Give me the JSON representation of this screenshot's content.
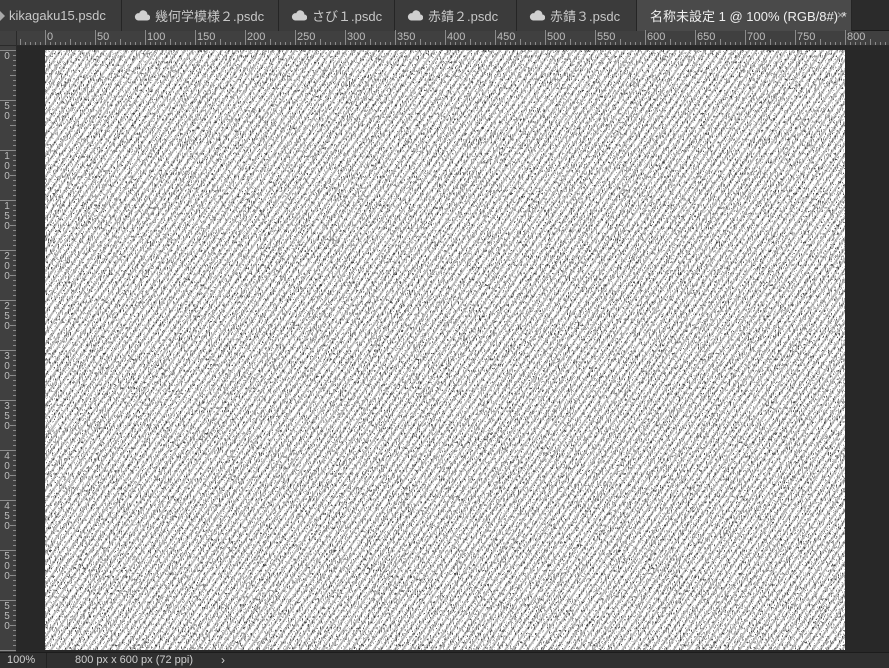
{
  "tabs": [
    {
      "label": "kikagaku15.psdc",
      "cloud": false,
      "active": false
    },
    {
      "label": "幾何学模様２.psdc",
      "cloud": true,
      "active": false
    },
    {
      "label": "さび１.psdc",
      "cloud": true,
      "active": false
    },
    {
      "label": "赤錆２.psdc",
      "cloud": true,
      "active": false
    },
    {
      "label": "赤錆３.psdc",
      "cloud": true,
      "active": false
    },
    {
      "label": "名称未設定 1 @ 100% (RGB/8#) *",
      "cloud": false,
      "active": true
    }
  ],
  "close_glyph": "×",
  "ruler_top_labels": [
    "0",
    "50",
    "100",
    "150",
    "200",
    "250",
    "300",
    "350",
    "400",
    "450",
    "500",
    "550",
    "600",
    "650",
    "700",
    "750",
    "800"
  ],
  "ruler_left_labels": [
    "0",
    "50",
    "100",
    "150",
    "200",
    "250",
    "300",
    "350",
    "400",
    "450",
    "500",
    "550"
  ],
  "status": {
    "zoom": "100%",
    "doc_size": "800 px x 600 px (72 ppi)",
    "arrow": "›"
  },
  "colors": {
    "ui_background": "#282828",
    "tab_active": "#4a4a4a",
    "texture_ink": "#161616",
    "texture_paper": "#ffffff"
  },
  "icons": {
    "cloud": "cloud-icon",
    "close": "close-icon"
  }
}
